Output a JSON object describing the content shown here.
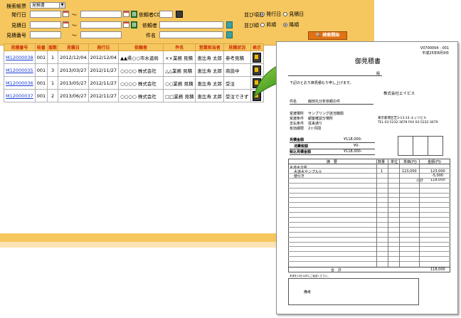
{
  "search": {
    "form_label": "検索帳票",
    "form_value": "見積書",
    "issue_date_label": "発行日",
    "due_date_label": "見積日",
    "number_label": "見積番号",
    "tilde": "～",
    "client_cd_label": "依頼者CD",
    "client_label": "依頼者",
    "subject_label": "件名",
    "sort_item_label": "並び項目",
    "sort_order_label": "並び順",
    "sort_options": [
      "発行日",
      "見積日"
    ],
    "order_options": [
      "昇順",
      "降順"
    ],
    "start_button": "検索開始"
  },
  "table": {
    "headers": [
      "見積番号",
      "枝番",
      "版数",
      "見積日",
      "発行日",
      "依頼者",
      "件名",
      "営業担当者",
      "見積状況",
      "表示"
    ],
    "rows": [
      {
        "no": "M12000038",
        "eda": "001",
        "ver": "1",
        "mitsumori": "2012/12/04",
        "hakko": "2012/12/04",
        "client": "▲▲県○○市水道局",
        "subject": "××業務",
        "kind": "見積",
        "staff": "恵比寿 太郎",
        "status": "参考見積"
      },
      {
        "no": "M12000035",
        "eda": "001",
        "ver": "3",
        "mitsumori": "2013/03/27",
        "hakko": "2012/11/27",
        "client": "○○○○ 株式会社",
        "subject": "△△業務",
        "kind": "見積",
        "staff": "恵比寿 太郎",
        "status": "商談中"
      },
      {
        "no": "M12000036",
        "eda": "001",
        "ver": "1",
        "mitsumori": "2013/05/27",
        "hakko": "2012/11/27",
        "client": "○○○○ 株式会社",
        "subject": "○○業務",
        "kind": "見積",
        "staff": "恵比寿 太郎",
        "status": "受注"
      },
      {
        "no": "M12000037",
        "eda": "001",
        "ver": "2",
        "mitsumori": "2013/06/27",
        "hakko": "2012/11/27",
        "client": "○○○○ 株式会社",
        "subject": "□□業務",
        "kind": "見積",
        "staff": "恵比寿 太郎",
        "status": "受注できず"
      }
    ]
  },
  "doc": {
    "doc_no": "V0700004 - 001",
    "doc_date": "平成25年8月9日",
    "title": "御見積書",
    "honorific": "殿",
    "greeting": "下記のとおり御見積もり申し上げます。",
    "company": "株式会社エイビス",
    "subject_label": "件名",
    "subject_value": "飯田丸分析依頼の件",
    "rows_left": [
      {
        "k": "受渡場所",
        "v": "サンプリング該当機関"
      },
      {
        "k": "受渡条件",
        "v": "顧客確認分場所"
      },
      {
        "k": "支払条件",
        "v": "従来通り"
      },
      {
        "k": "有効期限",
        "v": "2ヶ月間"
      }
    ],
    "address": "東京都港区芝3-13-14 エッツビル",
    "tel": "TEL 03-5232-3678   FAX 03-5232-3679",
    "sum_labels": [
      "見積金額",
      "消費税額",
      "税込見積金額"
    ],
    "sum_values": [
      "¥118,000-",
      "¥0-",
      "¥118,000-"
    ],
    "item_headers": [
      "摘　要",
      "数量",
      "単位",
      "単価(円)",
      "金額(円)"
    ],
    "items": [
      {
        "name": "水道水分析",
        "qty": "",
        "unit": "",
        "price": "",
        "amount": ""
      },
      {
        "name": "水道水サンプル①",
        "qty": "1",
        "unit": "",
        "price": "123,000",
        "amount": "123,000"
      },
      {
        "name": "値引き",
        "qty": "",
        "unit": "",
        "price": "",
        "amount": "-5,000"
      },
      {
        "name": "",
        "qty": "",
        "unit": "",
        "price": "小計",
        "amount": "118,000"
      }
    ],
    "total_label": "合　計",
    "total_value": "118,000",
    "note": "本書を10日以内にご返送ください。",
    "remarks_label": "備考"
  }
}
